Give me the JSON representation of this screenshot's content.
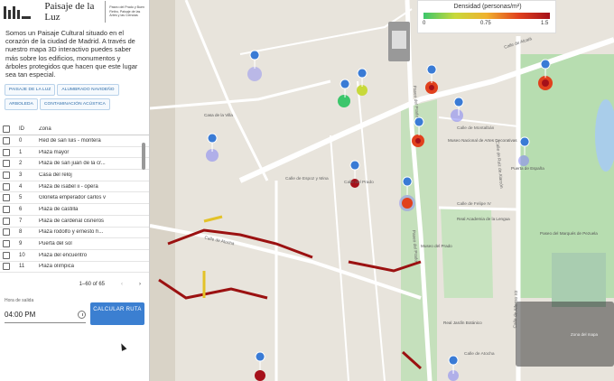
{
  "brand": {
    "name": "Paisaje de la Luz",
    "subtitle": "Paseo del Prado y Buen Retiro, Paisaje de las Artes y las Ciencias"
  },
  "intro": "Somos un Paisaje Cultural situado en el corazón de la ciudad de Madrid. A través de nuestro mapa 3D interactivo puedes saber más sobre los edificios, monumentos y árboles protegidos que hacen que este lugar sea tan especial.",
  "tabs": [
    "PAISAJE DE LA LUZ",
    "ALUMBRADO NAVIDEÑO",
    "ARBOLEDA",
    "CONTAMINACIÓN ACÚSTICA"
  ],
  "table": {
    "headers": {
      "id": "ID",
      "zone": "Zona"
    },
    "rows": [
      {
        "id": "0",
        "zone": "Red de san luis - montera"
      },
      {
        "id": "1",
        "zone": "Plaza mayor"
      },
      {
        "id": "2",
        "zone": "Plaza de san juan de la cr..."
      },
      {
        "id": "3",
        "zone": "Casa del reloj"
      },
      {
        "id": "4",
        "zone": "Plaza de isabel ii - opera"
      },
      {
        "id": "5",
        "zone": "Glorieta emperador carlos v"
      },
      {
        "id": "6",
        "zone": "Plaza de castilla"
      },
      {
        "id": "7",
        "zone": "Plaza de cardenal cisneros"
      },
      {
        "id": "8",
        "zone": "Plaza rodolfo y ernesto h..."
      },
      {
        "id": "9",
        "zone": "Puerta del sol"
      },
      {
        "id": "10",
        "zone": "Plaza del encuentro"
      },
      {
        "id": "11",
        "zone": "Plaza olímpica"
      }
    ],
    "pagination": "1–60 of 65"
  },
  "time": {
    "label": "Hora de salida",
    "value": "04:00 PM"
  },
  "calc_button": "CALCULAR RUTA",
  "legend": {
    "title": "Densidad (personas/m²)",
    "min": "0",
    "mid": "0.75",
    "max": "1.5",
    "colors": [
      "#3cc66b",
      "#c8d93a",
      "#f0b12e",
      "#e1411d",
      "#a5101a"
    ]
  },
  "map": {
    "streets": [
      "Calle de Alcalá",
      "Paseo del Prado",
      "Paseo del Prado",
      "Calle de Alfonso XII",
      "Calle de Atocha",
      "Calle de Felipe IV",
      "Calle de Ruiz de Alarcón",
      "Calle de Montalbán",
      "Calle de Espoz y Mina",
      "Calle del Prado",
      "Calle de Atocha"
    ],
    "pois": [
      "Museo del Prado",
      "Real Jardín Botánico",
      "Real Academia de la Lengua",
      "Museo Nacional de Artes Decorativas",
      "Puerta de España",
      "Paseo del Marqués de Pezuela",
      "Casa de la Villa"
    ],
    "panel_text": "Zona del mapa"
  }
}
